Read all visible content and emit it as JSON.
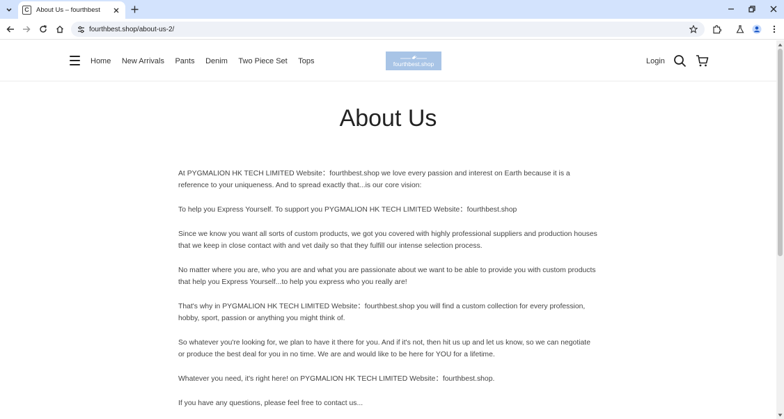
{
  "browser": {
    "tab_title": "About Us – fourthbest",
    "favicon_letter": "C",
    "url": "fourthbest.shop/about-us-2/"
  },
  "site": {
    "nav": [
      "Home",
      "New Arrivals",
      "Pants",
      "Denim",
      "Two Piece Set",
      "Tops"
    ],
    "logo_text": "fourthbest.shop",
    "login_label": "Login"
  },
  "page": {
    "title": "About Us",
    "paragraphs": [
      "At PYGMALION HK TECH LIMITED Website：fourthbest.shop we love every passion and interest on Earth because it is a reference to your uniqueness. And to spread exactly that...is our core vision:",
      "To help you Express Yourself. To support you PYGMALION HK TECH LIMITED Website：fourthbest.shop",
      "Since we know you want all sorts of custom products, we got you covered with highly professional suppliers and production houses that we keep in close contact with and vet daily so that they fulfill our intense selection process.",
      "No matter where you are, who you are and what you are passionate about we want to be able to provide you with custom products that help you Express Yourself...to help you express who you really are!",
      "That's why in PYGMALION HK TECH LIMITED Website：fourthbest.shop you will find a custom collection for every profession, hobby, sport, passion or anything you might think of.",
      "So whatever you're looking for, we plan to have it there for you. And if it's not, then hit us up and let us know, so we can negotiate or produce the best deal for you in no time. We are and would like to be here for YOU for a lifetime.",
      "Whatever you need, it's right here! on PYGMALION HK TECH LIMITED Website：fourthbest.shop.",
      "If you have any questions, please feel free to contact us..."
    ]
  },
  "colors": {
    "tabstrip": "#d3e3fd",
    "omnibox": "#eef1f7",
    "logo_bg": "#a8c4e6"
  }
}
